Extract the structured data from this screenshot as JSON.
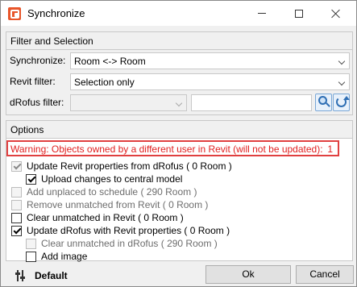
{
  "window": {
    "title": "Synchronize"
  },
  "filter_section": {
    "header": "Filter and Selection",
    "synchronize": {
      "label": "Synchronize:",
      "value": "Room <-> Room"
    },
    "revit_filter": {
      "label": "Revit filter:",
      "value": "Selection only"
    },
    "drofus_filter": {
      "label": "dRofus filter:",
      "value": "",
      "text_value": ""
    }
  },
  "options_section": {
    "header": "Options",
    "warning_text": "Warning: Objects owned by a different user in Revit (will not be updated):",
    "warning_count": "1",
    "options": [
      {
        "label": "Update Revit properties from dRofus ( 0 Room )",
        "checked": true,
        "enabled": false
      },
      {
        "label": "Upload changes to central model",
        "checked": true,
        "enabled": true
      },
      {
        "label": "Add unplaced to schedule ( 290 Room )",
        "checked": false,
        "enabled": false
      },
      {
        "label": "Remove unmatched from Revit ( 0 Room )",
        "checked": false,
        "enabled": false
      },
      {
        "label": "Clear unmatched in Revit ( 0 Room )",
        "checked": false,
        "enabled": true
      },
      {
        "label": "Update dRofus with Revit properties ( 0 Room )",
        "checked": true,
        "enabled": true
      },
      {
        "label": "Clear unmatched in dRofus ( 290 Room )",
        "checked": false,
        "enabled": false
      },
      {
        "label": "Add image",
        "checked": false,
        "enabled": true
      }
    ]
  },
  "footer": {
    "default_label": "Default",
    "ok_label": "Ok",
    "cancel_label": "Cancel"
  },
  "colors": {
    "warning": "#e02020",
    "warning_border": "#e04040"
  }
}
